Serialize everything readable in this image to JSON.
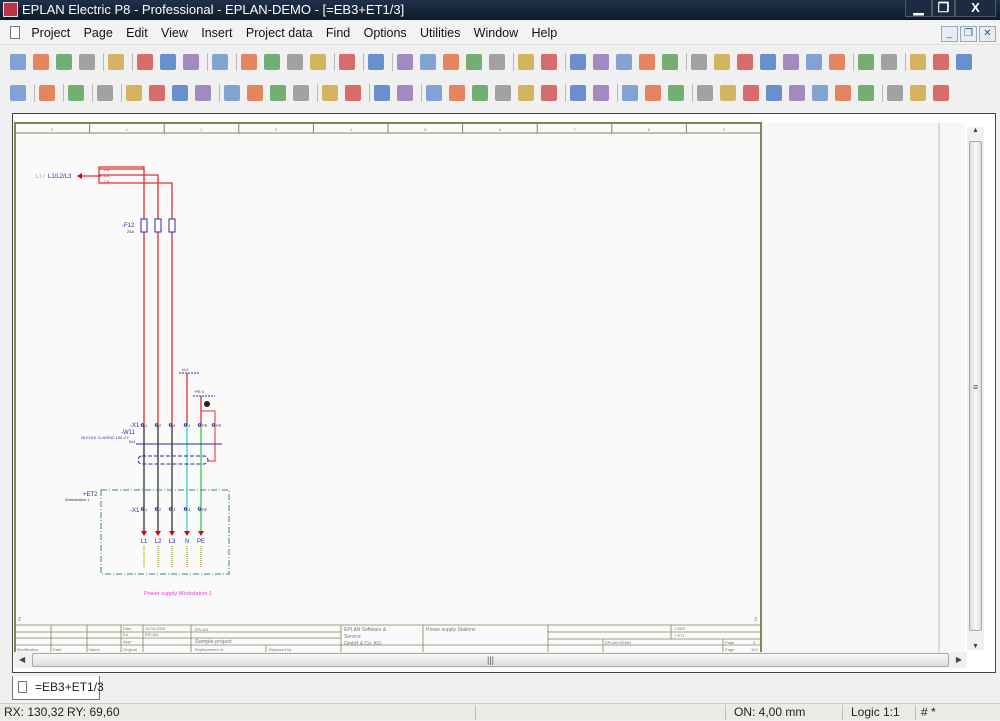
{
  "window": {
    "title": "EPLAN Electric P8 - Professional - EPLAN-DEMO - [=EB3+ET1/3]",
    "minimize": "▁",
    "restore": "❐",
    "close": "X"
  },
  "menu": [
    "Project",
    "Page",
    "Edit",
    "View",
    "Insert",
    "Project data",
    "Find",
    "Options",
    "Utilities",
    "Window",
    "Help"
  ],
  "mdi_controls": {
    "minimize": "_",
    "restore": "❐",
    "close": "✕"
  },
  "toolbar1_icons": [
    "open-project-icon",
    "new-project-icon",
    "backup-project-icon",
    "print-icon",
    "settings-wrench-icon",
    "cut-icon",
    "copy-icon",
    "paste-icon",
    "delete-icon",
    "undo-list-icon",
    "undo-icon",
    "redo-icon",
    "redo-list-icon",
    "properties-icon",
    "graphics-preview-icon",
    "refresh-icon",
    "zoom-window-icon",
    "zoom-in-icon",
    "zoom-out-icon",
    "zoom-100-icon",
    "back-icon",
    "forward-icon",
    "snap-grid-a-icon",
    "snap-grid-b-icon",
    "snap-grid-c-icon",
    "snap-grid-d-icon",
    "snap-grid-e-icon",
    "grid-icon",
    "snap-to-object-icon",
    "center-icon",
    "symbol-icon",
    "connection-icon",
    "link-icon",
    "macro-icon",
    "find-icon",
    "find-replace-icon",
    "connection-break-icon",
    "cable-icon",
    "cross-icon"
  ],
  "toolbar2_icons": [
    "page-navigator-icon",
    "device-icon",
    "terminal-icon",
    "potential-icon",
    "angle-top-left-icon",
    "angle-top-right-icon",
    "angle-bottom-left-icon",
    "angle-bottom-right-icon",
    "t-node-a-icon",
    "t-node-b-icon",
    "t-node-c-icon",
    "t-node-d-icon",
    "jumper-a-icon",
    "jumper-b-icon",
    "interruption-icon",
    "diagonal-icon",
    "page-new-icon",
    "page-open-icon",
    "page-copy-icon",
    "page-back-icon",
    "page-prev-icon",
    "page-next-icon",
    "text-icon",
    "image-icon",
    "cable-def-icon",
    "shield-icon",
    "pot-def-icon",
    "terminal-strip-icon",
    "plc-a-icon",
    "plc-b-icon",
    "plc-c-icon",
    "plc-d-icon",
    "black-box-icon",
    "structure-box-icon",
    "bus-icon",
    "form-icon",
    "hatch-icon",
    "dimension-icon"
  ],
  "drawing": {
    "columns": [
      "0",
      "1",
      "2",
      "3",
      "4",
      "5",
      "6",
      "7",
      "8",
      "9"
    ],
    "row_left": "2",
    "row_right": "3",
    "interruption_label": "L1 / L1/L2/L3",
    "interruption_prefix": "L1 /",
    "interruption_name": "L1/L2/L3",
    "fuse_tag": "-F12",
    "fuse_rating": "25A",
    "terminal_tag": "-X1",
    "cable_tag": "-W11",
    "cable_type": "ÖLFLEX CLASSIC 100 CY",
    "cable_size": "5x4",
    "n_potential": "N:4",
    "pe_potential": "PE:4",
    "location_tag": "+ET2",
    "location_desc": "Workstation 1",
    "terminals_top": [
      "1",
      "2",
      "3",
      "4",
      "PE",
      "PE"
    ],
    "terminals_bottom": [
      "1",
      "2",
      "3",
      "4",
      "PE"
    ],
    "outputs": [
      "L1",
      "L2",
      "L3",
      "N",
      "PE"
    ],
    "footer_text": "Power supply Workstation 1",
    "title_block": {
      "date_label": "Date",
      "date_value": "13.04.2005",
      "ed_label": "Ed.",
      "ed_value": "EPLAN",
      "appr_label": "Appr",
      "original_label": "Original",
      "modification_label": "Modification",
      "date_col": "Date",
      "name_col": "Name",
      "company": "EPLAN",
      "project": "Sample project",
      "replacement_label": "Replacement of",
      "replaced_label": "Replaced by",
      "vendor1": "EPLAN Software &",
      "vendor2": "Service",
      "vendor3": "GmbH & Co. KG",
      "page_desc": "Power supply Stations",
      "eq": "= EB3",
      "loc": "+ ET1",
      "demo": "EPLAN DEMO",
      "page_label": "Page",
      "page_value": "3",
      "pages_label": "Page",
      "pages_value": "102"
    }
  },
  "tab": {
    "label": "=EB3+ET1/3"
  },
  "status": {
    "rx": "RX: 130,32",
    "ry": "RY: 69,60",
    "grid": "ON: 4,00 mm",
    "logic": "Logic 1:1",
    "hash": "# *"
  }
}
